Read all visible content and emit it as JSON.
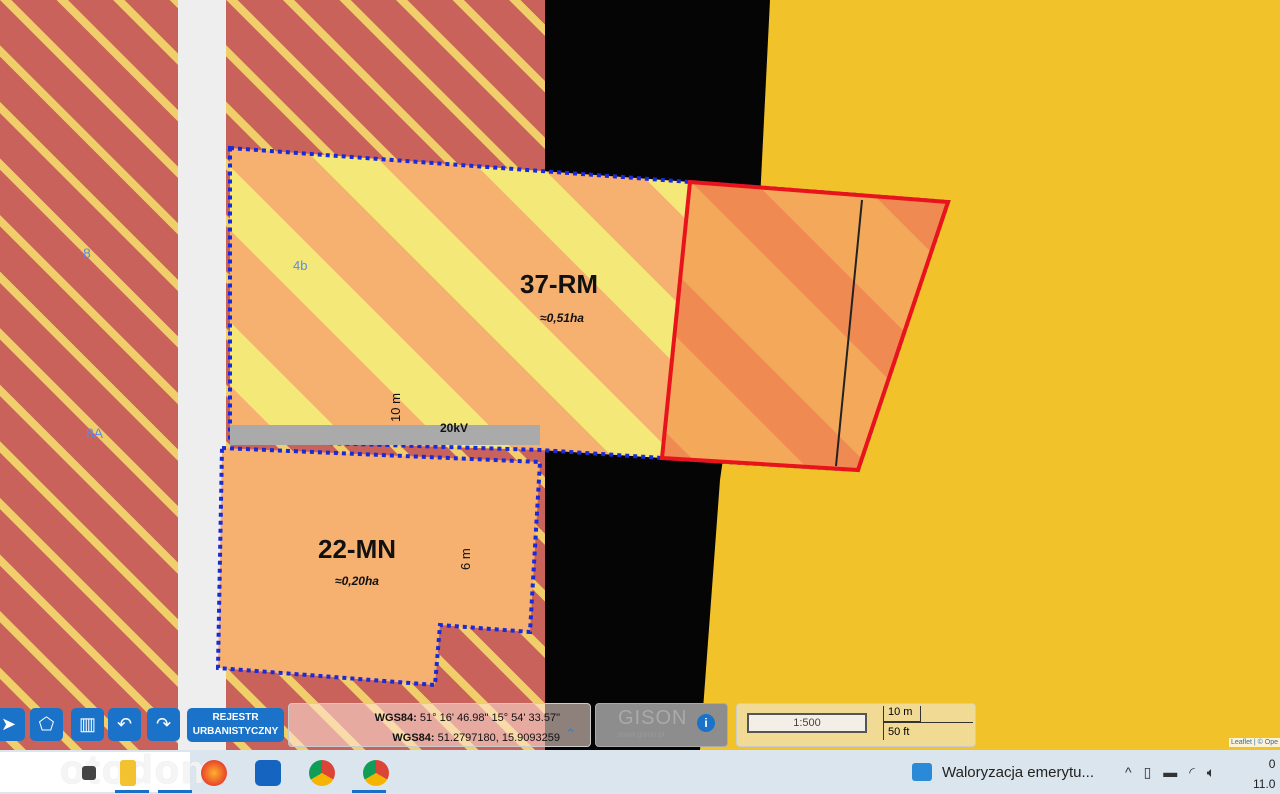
{
  "map": {
    "zones": [
      {
        "code": "37-RM",
        "area": "≈0,51ha"
      },
      {
        "code": "22-MN",
        "area": "≈0,20ha"
      }
    ],
    "annotations": {
      "line": "20kV",
      "dist1": "10 m",
      "dist2": "6 m",
      "markers": [
        "4b",
        "8",
        "8A"
      ]
    },
    "colors": {
      "red_zone": "#c8625a",
      "yellow": "#f2c22a",
      "orange": "#f4a860",
      "selection": "#e8131b",
      "boundary": "#1a2ad8"
    }
  },
  "toolbar": {
    "rejestr_line1": "REJESTR",
    "rejestr_line2": "URBANISTYCZNY"
  },
  "coords": {
    "label": "WGS84:",
    "dms": "51° 16' 46.98\" 15° 54' 33.57\"",
    "decimal": "51.2797180, 15.9093259"
  },
  "gison": {
    "name": "GISON",
    "url": "www.gison.pl"
  },
  "scale": {
    "ratio": "1:500",
    "metric": "10 m",
    "imperial": "50 ft"
  },
  "attribution": "Leaflet | © Ope",
  "watermark": "otodom",
  "taskbar": {
    "news": "Waloryzacja emerytu...",
    "clock_time": "0",
    "clock_date": "11.0"
  }
}
